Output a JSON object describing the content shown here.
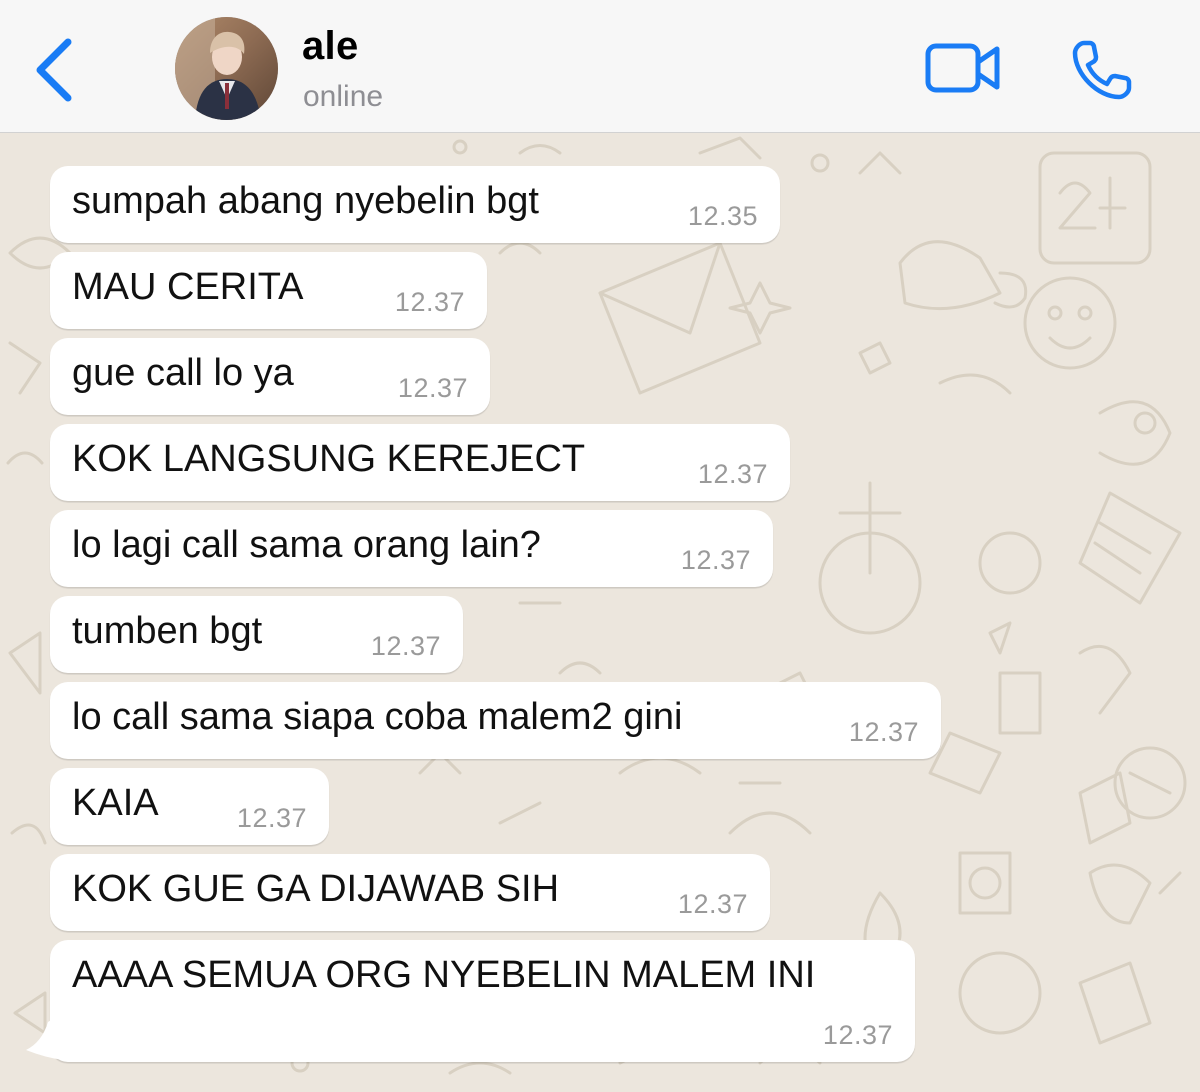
{
  "header": {
    "contact_name": "ale",
    "contact_status": "online",
    "back_icon": "chevron-left-icon",
    "video_icon": "video-camera-icon",
    "call_icon": "phone-icon",
    "accent_color": "#1a7cf5"
  },
  "messages": [
    {
      "text": "sumpah abang nyebelin bgt",
      "time": "12.35"
    },
    {
      "text": "MAU CERITA",
      "time": "12.37"
    },
    {
      "text": "gue call lo ya",
      "time": "12.37"
    },
    {
      "text": "KOK LANGSUNG KEREJECT",
      "time": "12.37"
    },
    {
      "text": "lo lagi call sama orang lain?",
      "time": "12.37"
    },
    {
      "text": "tumben bgt",
      "time": "12.37"
    },
    {
      "text": "lo call sama siapa coba malem2 gini",
      "time": "12.37"
    },
    {
      "text": "KAIA",
      "time": "12.37"
    },
    {
      "text": "KOK GUE GA DIJAWAB SIH",
      "time": "12.37"
    },
    {
      "text": "AAAA SEMUA ORG NYEBELIN MALEM INI",
      "time": "12.37"
    }
  ]
}
